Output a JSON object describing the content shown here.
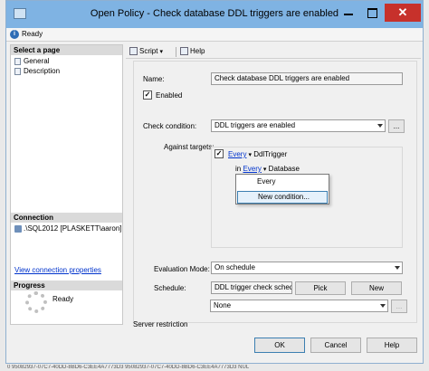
{
  "window": {
    "title": "Open Policy - Check database DDL triggers are enabled",
    "close_glyph": "✕"
  },
  "status": {
    "text": "Ready",
    "icon": "info-icon",
    "icon_glyph": "i"
  },
  "left_pane": {
    "select_page_header": "Select a page",
    "pages": [
      {
        "label": "General",
        "icon": "page-icon"
      },
      {
        "label": "Description",
        "icon": "page-icon"
      }
    ],
    "connection_header": "Connection",
    "connection_item": ".\\SQL2012 [PLASKETT\\aaron]",
    "connection_link": "View connection properties",
    "progress_header": "Progress",
    "progress_status": "Ready"
  },
  "toolbar": {
    "script_label": "Script",
    "help_label": "Help"
  },
  "form": {
    "name_label": "Name:",
    "name_value": "Check database DDL triggers are enabled",
    "enabled_label": "Enabled",
    "enabled_check": "✓",
    "check_condition_label": "Check condition:",
    "check_condition_value": "DDL triggers are enabled",
    "ellipsis_label": "...",
    "against_targets_label": "Against targets:",
    "target1": {
      "check": "✓",
      "link": "Every",
      "type": "DdlTrigger"
    },
    "target2": {
      "prefix": "in",
      "link": "Every",
      "type": "Database"
    },
    "dropdown_items": [
      "Every",
      "New condition..."
    ],
    "evaluation_mode_label": "Evaluation Mode:",
    "evaluation_mode_value": "On schedule",
    "schedule_label": "Schedule:",
    "schedule_value": "DDL trigger check schedu",
    "pick_label": "Pick",
    "new_label": "New",
    "server_restriction_label": "Server restriction",
    "server_restriction_value": "None"
  },
  "buttons": {
    "ok": "OK",
    "cancel": "Cancel",
    "help": "Help"
  },
  "background_row": "0          95082937-07C7-40DD-8BD6-C3EE4A7773D3     95082937-07C7-40DD-8BD6-C3EE4A7773D3   NUL"
}
